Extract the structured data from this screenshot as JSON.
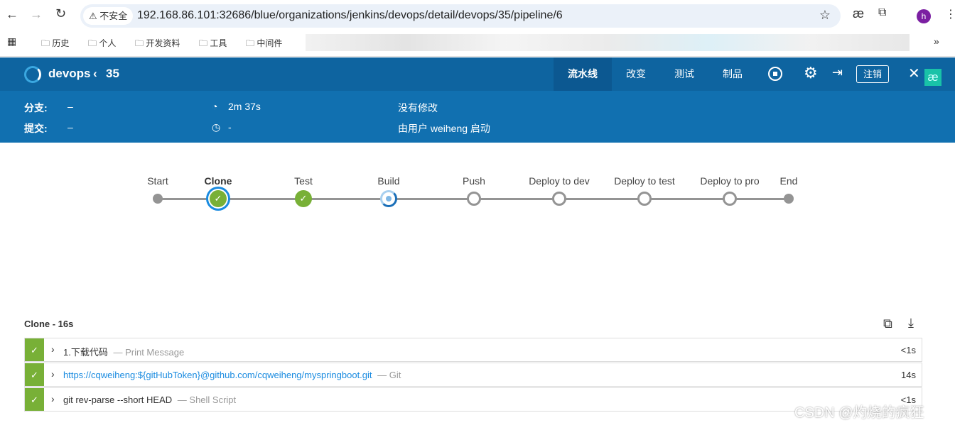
{
  "browser": {
    "security_label": "不安全",
    "url": "192.168.86.101:32686/blue/organizations/jenkins/devops/detail/devops/35/pipeline/6",
    "profile_initial": "h",
    "bookmarks": [
      "历史",
      "个人",
      "开发资料",
      "工具",
      "中间件"
    ]
  },
  "header": {
    "title": "devops",
    "run": "35",
    "tabs": [
      "流水线",
      "改变",
      "测试",
      "制品"
    ],
    "logout": "注销"
  },
  "summary": {
    "branch_label": "分支:",
    "branch_value": "–",
    "commit_label": "提交:",
    "commit_value": "–",
    "duration": "2m 37s",
    "time": "-",
    "changes": "没有修改",
    "started_by": "由用户 weiheng 启动"
  },
  "pipeline": {
    "stages": [
      {
        "name": "Start",
        "status": "start"
      },
      {
        "name": "Clone",
        "status": "success",
        "selected": true
      },
      {
        "name": "Test",
        "status": "success"
      },
      {
        "name": "Build",
        "status": "running"
      },
      {
        "name": "Push",
        "status": "pending"
      },
      {
        "name": "Deploy to dev",
        "status": "pending"
      },
      {
        "name": "Deploy to test",
        "status": "pending"
      },
      {
        "name": "Deploy to pro",
        "status": "pending"
      },
      {
        "name": "End",
        "status": "end"
      }
    ]
  },
  "steps": {
    "title": "Clone - 16s",
    "items": [
      {
        "name": "1.下载代码",
        "type": "— Print Message",
        "duration": "<1s",
        "link": false
      },
      {
        "name": "https://cqweiheng:${gitHubToken}@github.com/cqweiheng/myspringboot.git",
        "type": "— Git",
        "duration": "14s",
        "link": true
      },
      {
        "name": "git rev-parse --short HEAD",
        "type": "— Shell Script",
        "duration": "<1s",
        "link": false
      }
    ]
  },
  "watermark": "CSDN @灼烧的疯狂",
  "colors": {
    "header": "#0e64a0",
    "subheader": "#1170b0",
    "success": "#78b037",
    "running": "#4a90d9",
    "link": "#1a8be0"
  }
}
